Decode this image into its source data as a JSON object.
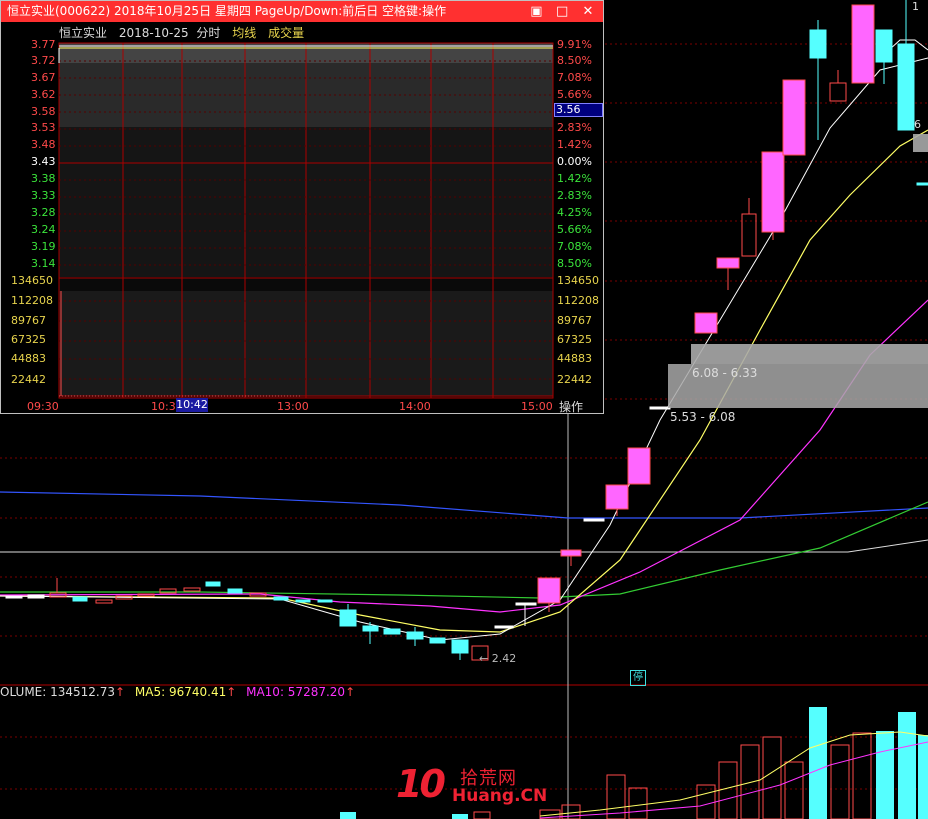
{
  "popup": {
    "title": "恒立实业(000622) 2018年10月25日 星期四 PageUp/Down:前后日 空格键:操作",
    "stock_name": "恒立实业",
    "date": "2018-10-25",
    "mode": "分时",
    "avg_line_label": "均线",
    "volume_label": "成交量",
    "price_labels": [
      "3.77",
      "3.72",
      "3.67",
      "3.62",
      "3.58",
      "3.53",
      "3.48",
      "3.43",
      "3.38",
      "3.33",
      "3.28",
      "3.24",
      "3.19",
      "3.14"
    ],
    "pct_labels": [
      "9.91%",
      "8.50%",
      "7.08%",
      "5.66%",
      "3.56",
      "2.83%",
      "1.42%",
      "0.00%",
      "1.42%",
      "2.83%",
      "4.25%",
      "5.66%",
      "7.08%",
      "8.50%"
    ],
    "vol_labels": [
      "134650",
      "112208",
      "89767",
      "67325",
      "44883",
      "22442"
    ],
    "time_labels": [
      "09:30",
      "10:3",
      "13:00",
      "14:00",
      "15:00"
    ],
    "cursor_time": "10:42",
    "cursor_price": "3.56",
    "operate_button": "操作"
  },
  "kline": {
    "range_upper": "6.08 - 6.33",
    "range_lower": "5.53 - 6.08",
    "low_marker": "2.42",
    "stop_badge": "停",
    "top_marker": "1",
    "side_marker": "6"
  },
  "volume_legend": {
    "volume": "OLUME: 134512.73",
    "ma5": "MA5: 96740.41",
    "ma10": "MA10: 57287.20"
  },
  "watermark": {
    "num": "10",
    "cn": "拾荒网",
    "en": "Huang.CN"
  },
  "colors": {
    "up": "#ff4a4a",
    "up_fill": "#ff66ff",
    "down": "#55ffff",
    "ma5": "#ffff66",
    "ma10": "#ff33ff",
    "ma20": "#33cc33",
    "ma60": "#3355ff"
  }
}
